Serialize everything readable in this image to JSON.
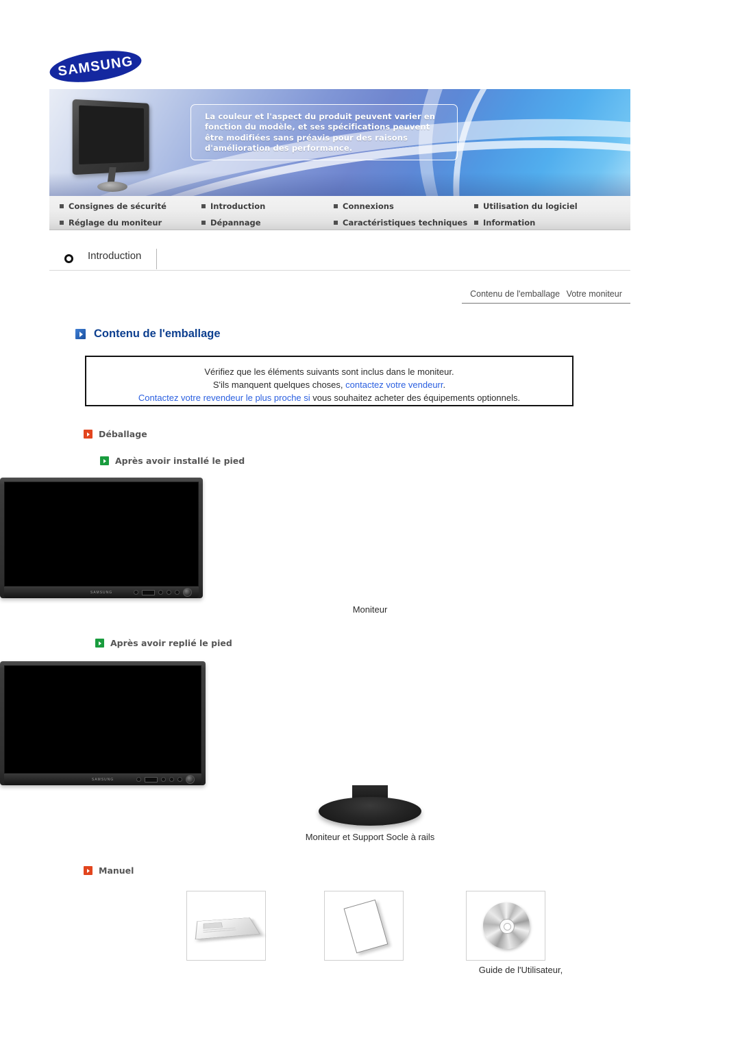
{
  "brand": {
    "logo_text": "SAMSUNG"
  },
  "banner": {
    "notice_lines": [
      "La couleur et l'aspect du produit peuvent varier en",
      "fonction du modèle, et ses spécifications peuvent",
      "être modifiées sans préavis pour des raisons",
      "d'amélioration des performance."
    ]
  },
  "nav": {
    "row1": [
      {
        "label": "Consignes de sécurité"
      },
      {
        "label": "Introduction"
      },
      {
        "label": "Connexions"
      },
      {
        "label": "Utilisation du logiciel"
      }
    ],
    "row2": [
      {
        "label": "Réglage du moniteur"
      },
      {
        "label": "Dépannage"
      },
      {
        "label": "Caractéristiques techniques"
      },
      {
        "label": "Information"
      }
    ]
  },
  "section": {
    "tab_label": "Introduction"
  },
  "breadcrumb": {
    "item1": "Contenu de l'emballage",
    "item2": "Votre moniteur"
  },
  "heading": {
    "title": "Contenu de l'emballage"
  },
  "notice": {
    "line1": "Vérifiez que les éléments suivants sont inclus dans le moniteur.",
    "line2_prefix": "S'ils manquent quelques choses, ",
    "line2_link": "contactez votre vendeurr",
    "line2_suffix": ".",
    "line3_link": "Contactez votre revendeur le plus proche si",
    "line3_suffix": " vous souhaitez acheter des équipements optionnels."
  },
  "sections": {
    "deballage": "Déballage",
    "apres_installe": "Après avoir installé le pied",
    "apres_replie": "Après avoir replié le pied",
    "manuel": "Manuel"
  },
  "figures": {
    "monitor_caption": "Moniteur",
    "monitor_stand_caption": "Moniteur et Support Socle à rails",
    "manual_caption": "Guide de l'Utilisateur,",
    "monitor_brand": "SAMSUNG"
  },
  "colors": {
    "heading_blue": "#0d3f8f",
    "link_blue": "#2a5fe0",
    "icon_red": "#e2451e",
    "icon_green": "#199c3e",
    "samsung_blue": "#1428A0"
  }
}
